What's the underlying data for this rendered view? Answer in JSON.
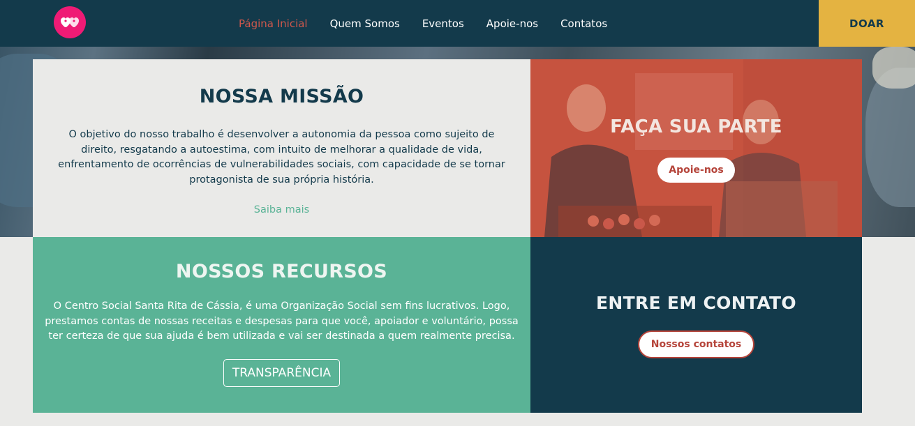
{
  "nav": {
    "items": [
      "Página Inicial",
      "Quem Somos",
      "Eventos",
      "Apoie-nos",
      "Contatos"
    ],
    "donate_label": "DOAR"
  },
  "missao": {
    "title": "NOSSA MISSÃO",
    "text": "O objetivo do nosso trabalho é desenvolver a autonomia da pessoa como sujeito de direito, resgatando a autoestima, com intuito de melhorar a qualidade de vida, enfrentamento de ocorrências de vulnerabilidades sociais, com capacidade de se tornar protagonista de sua própria história.",
    "link": "Saiba mais"
  },
  "parte": {
    "title": "FAÇA SUA PARTE",
    "button": "Apoie-nos"
  },
  "recursos": {
    "title": "NOSSOS RECURSOS",
    "text": "O Centro Social Santa Rita de Cássia, é uma Organização Social sem fins lucrativos. Logo, prestamos contas de nossas receitas e despesas para que você, apoiador e voluntário, possa ter certeza de que sua ajuda é bem utilizada e vai ser destinada a quem realmente precisa.",
    "button": "TRANSPARÊNCIA"
  },
  "contato": {
    "title": "ENTRE EM CONTATO",
    "button": "Nossos contatos"
  },
  "colors": {
    "navy": "#133a4b",
    "green": "#5ab396",
    "coral": "#c6533f",
    "gold": "#e4b341",
    "logo_pink": "#ef1b75"
  },
  "icons": {
    "logo": "hearts-logo-icon"
  }
}
